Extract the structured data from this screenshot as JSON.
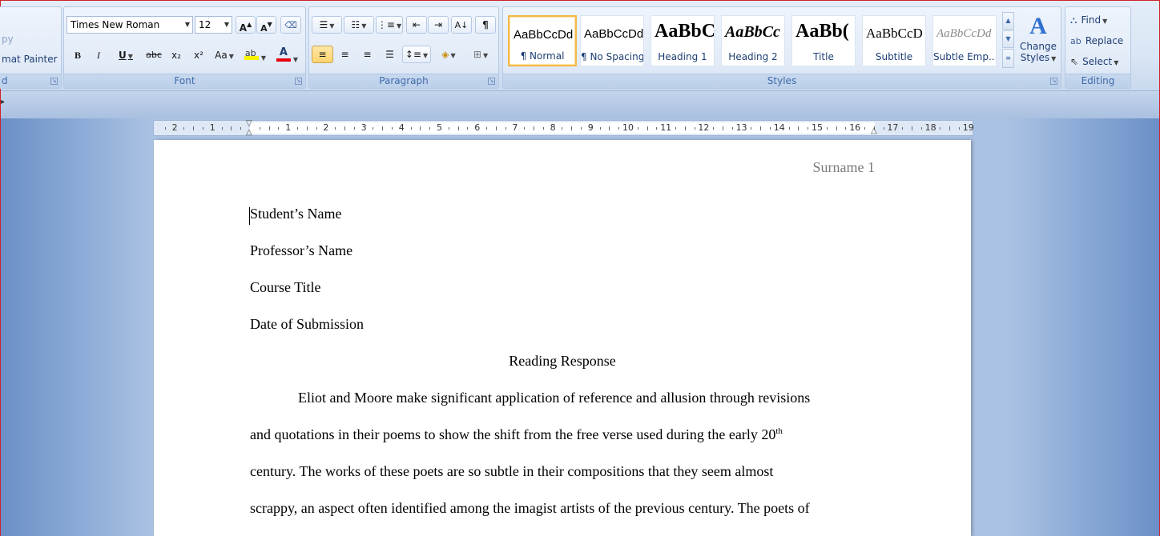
{
  "clipboard": {
    "copy_fragment": "py",
    "format_painter_fragment": "mat Painter",
    "group_label_fragment": "d"
  },
  "font": {
    "family": "Times New Roman",
    "size": "12",
    "group_label": "Font",
    "bold": "B",
    "italic": "I",
    "underline": "U",
    "strike": "abc",
    "subscript": "x₂",
    "superscript": "x²",
    "change_case": "Aa",
    "grow": "A",
    "shrink": "A"
  },
  "paragraph": {
    "group_label": "Paragraph"
  },
  "styles": {
    "group_label": "Styles",
    "items": [
      {
        "sample": "AaBbCcDd",
        "name": "¶ Normal"
      },
      {
        "sample": "AaBbCcDd",
        "name": "¶ No Spacing"
      },
      {
        "sample": "AaBbC(",
        "name": "Heading 1"
      },
      {
        "sample": "AaBbCc",
        "name": "Heading 2"
      },
      {
        "sample": "AaBb(",
        "name": "Title"
      },
      {
        "sample": "AaBbCcD",
        "name": "Subtitle"
      },
      {
        "sample": "AaBbCcDd",
        "name": "Subtle Emp..."
      }
    ],
    "change_styles_line1": "Change",
    "change_styles_line2": "Styles"
  },
  "editing": {
    "group_label": "Editing",
    "find": "Find",
    "replace": "Replace",
    "select": "Select"
  },
  "ruler": {
    "labels": [
      "2",
      "1",
      "1",
      "2",
      "3",
      "4",
      "5",
      "6",
      "7",
      "8",
      "9",
      "10",
      "11",
      "12",
      "13",
      "14",
      "15",
      "16",
      "17",
      "18",
      "19"
    ]
  },
  "document": {
    "header": "Surname 1",
    "lines": {
      "student": "Student’s Name",
      "professor": "Professor’s Name",
      "course": "Course Title",
      "date": "Date of Submission",
      "title": "Reading Response",
      "p1": "Eliot and Moore make significant application of reference and allusion through revisions",
      "p2": "and quotations in their poems to show the shift from the free verse used during the early 20",
      "p2_sup": "th",
      "p3": "century. The works of these poets are so subtle in their compositions that they seem almost",
      "p4": "scrappy, an aspect often identified among the imagist artists of the previous century. The poets of"
    }
  },
  "colors": {
    "highlight": "#f7f300",
    "font_color": "#e8000f",
    "selected_style_border": "#f2b84b"
  }
}
